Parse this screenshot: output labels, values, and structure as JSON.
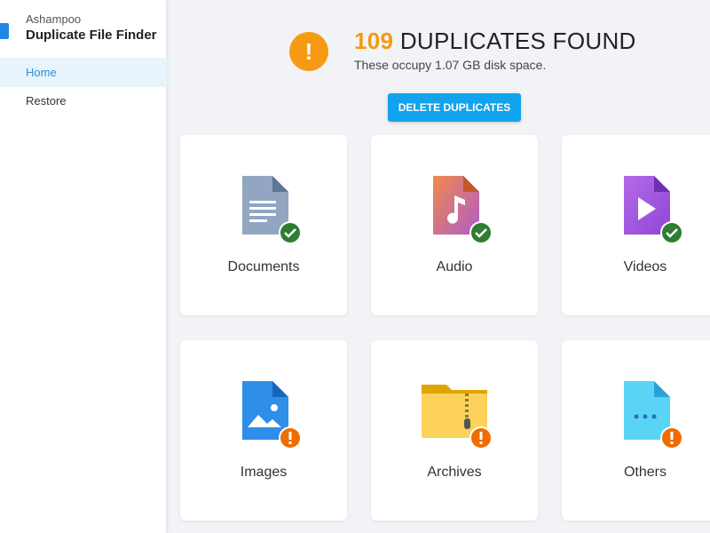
{
  "sidebar": {
    "brand": "Ashampoo",
    "app_name": "Duplicate File Finder",
    "items": [
      {
        "label": "Home",
        "active": true
      },
      {
        "label": "Restore",
        "active": false
      }
    ]
  },
  "header": {
    "count": "109",
    "title": "DUPLICATES FOUND",
    "subtitle": "These occupy 1.07 GB disk space.",
    "icon": "warning-icon",
    "accent": "#f59a12"
  },
  "actions": {
    "delete_label": "DELETE DUPLICATES",
    "color": "#12a3ee"
  },
  "categories": [
    {
      "label": "Documents",
      "icon": "document-icon",
      "status": "checked"
    },
    {
      "label": "Audio",
      "icon": "audio-file-icon",
      "status": "checked"
    },
    {
      "label": "Videos",
      "icon": "video-file-icon",
      "status": "checked"
    },
    {
      "label": "Images",
      "icon": "image-file-icon",
      "status": "warning"
    },
    {
      "label": "Archives",
      "icon": "archive-folder-icon",
      "status": "warning"
    },
    {
      "label": "Others",
      "icon": "other-file-icon",
      "status": "warning"
    }
  ],
  "status_colors": {
    "checked": "#2e7d32",
    "warning": "#ef6c00"
  }
}
